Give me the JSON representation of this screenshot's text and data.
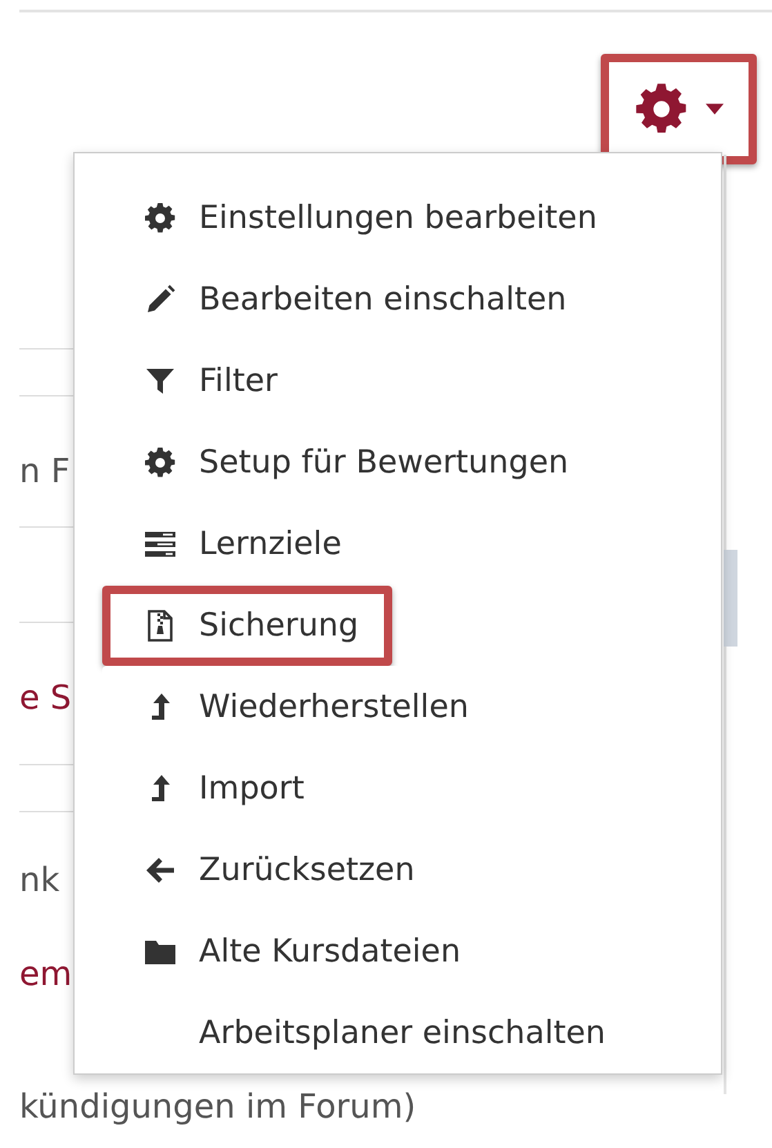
{
  "background": {
    "fragments": [
      {
        "text": "n F",
        "kind": "plain"
      },
      {
        "text": "e S",
        "kind": "link"
      },
      {
        "text": "nk",
        "kind": "plain"
      },
      {
        "text": "em",
        "kind": "link"
      },
      {
        "text": "kündigungen im Forum)",
        "kind": "plain"
      }
    ]
  },
  "settings_button": {
    "highlighted": true
  },
  "menu": {
    "items": [
      {
        "label": "Einstellungen bearbeiten",
        "kind": "gear",
        "highlighted": false
      },
      {
        "label": "Bearbeiten einschalten",
        "kind": "pencil",
        "highlighted": false
      },
      {
        "label": "Filter",
        "kind": "filter",
        "highlighted": false
      },
      {
        "label": "Setup für Bewertungen",
        "kind": "gear",
        "highlighted": false
      },
      {
        "label": "Lernziele",
        "kind": "list",
        "highlighted": false
      },
      {
        "label": "Sicherung",
        "kind": "archive",
        "highlighted": true
      },
      {
        "label": "Wiederherstellen",
        "kind": "up",
        "highlighted": false
      },
      {
        "label": "Import",
        "kind": "up",
        "highlighted": false
      },
      {
        "label": "Zurücksetzen",
        "kind": "left",
        "highlighted": false
      },
      {
        "label": "Alte Kursdateien",
        "kind": "folder",
        "highlighted": false
      },
      {
        "label": "Arbeitsplaner einschalten",
        "kind": "plain",
        "highlighted": false
      }
    ]
  }
}
